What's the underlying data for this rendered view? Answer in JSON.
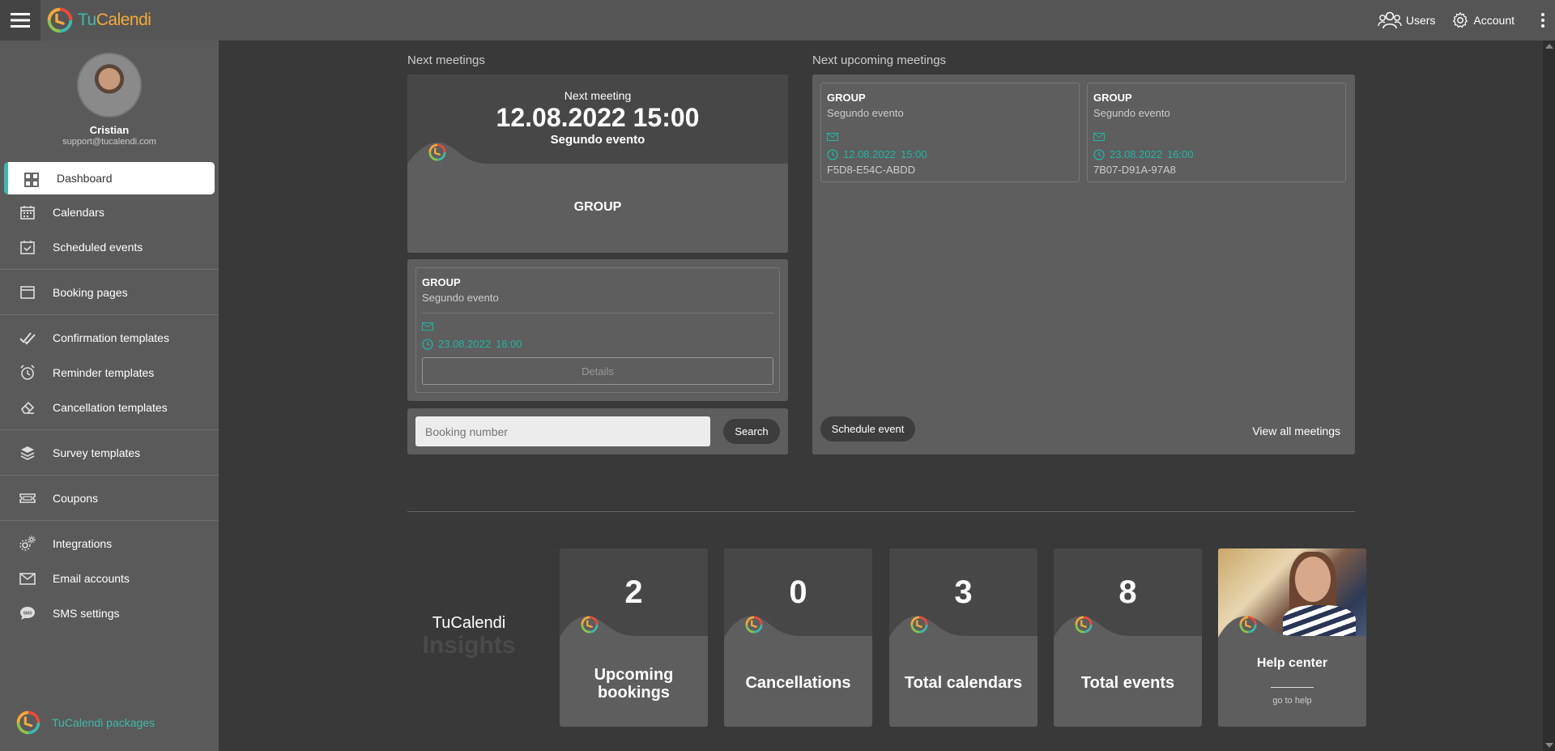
{
  "app": {
    "brand_prefix": "Tu",
    "brand_suffix": "Calendi"
  },
  "topbar": {
    "users_label": "Users",
    "account_label": "Account"
  },
  "user": {
    "name": "Cristian",
    "email": "support@tucalendi.com"
  },
  "sidebar": {
    "items": [
      {
        "label": "Dashboard",
        "icon": "grid-icon",
        "active": true
      },
      {
        "label": "Calendars",
        "icon": "calendar-icon"
      },
      {
        "label": "Scheduled events",
        "icon": "calendar-check-icon"
      },
      {
        "label": "Booking pages",
        "icon": "browser-window-icon"
      },
      {
        "label": "Confirmation templates",
        "icon": "double-check-icon"
      },
      {
        "label": "Reminder templates",
        "icon": "alarm-clock-icon"
      },
      {
        "label": "Cancellation templates",
        "icon": "eraser-icon"
      },
      {
        "label": "Survey templates",
        "icon": "layers-icon"
      },
      {
        "label": "Coupons",
        "icon": "ticket-icon"
      },
      {
        "label": "Integrations",
        "icon": "gears-icon"
      },
      {
        "label": "Email accounts",
        "icon": "envelope-icon"
      },
      {
        "label": "SMS settings",
        "icon": "sms-bubble-icon"
      }
    ],
    "packages_label": "TuCalendi packages"
  },
  "next_meetings": {
    "section_title": "Next meetings",
    "card_label": "Next meeting",
    "date": "12.08.2022 15:00",
    "event": "Segundo evento",
    "group": "GROUP",
    "list": [
      {
        "group": "GROUP",
        "event": "Segundo evento",
        "date": "23.08.2022",
        "time": "16:00",
        "details_label": "Details"
      }
    ]
  },
  "search": {
    "placeholder": "Booking number",
    "button_label": "Search"
  },
  "upcoming": {
    "section_title": "Next upcoming meetings",
    "cards": [
      {
        "group": "GROUP",
        "event": "Segundo evento",
        "date": "12.08.2022",
        "time": "15:00",
        "code": "F5D8-E54C-ABDD"
      },
      {
        "group": "GROUP",
        "event": "Segundo evento",
        "date": "23.08.2022",
        "time": "16:00",
        "code": "7B07-D91A-97A8"
      }
    ],
    "schedule_label": "Schedule event",
    "view_all_label": "View all meetings"
  },
  "insights": {
    "title": "TuCalendi",
    "subtitle": "Insights",
    "stats": [
      {
        "value": "2",
        "label": "Upcoming bookings"
      },
      {
        "value": "0",
        "label": "Cancellations"
      },
      {
        "value": "3",
        "label": "Total calendars"
      },
      {
        "value": "8",
        "label": "Total events"
      }
    ],
    "help": {
      "label": "Help center",
      "link": "go to help"
    }
  },
  "colors": {
    "accent": "#3fb8a8",
    "brand_orange": "#f2a93b",
    "sidebar_bg": "#5a5a5a",
    "content_bg": "#393939"
  }
}
